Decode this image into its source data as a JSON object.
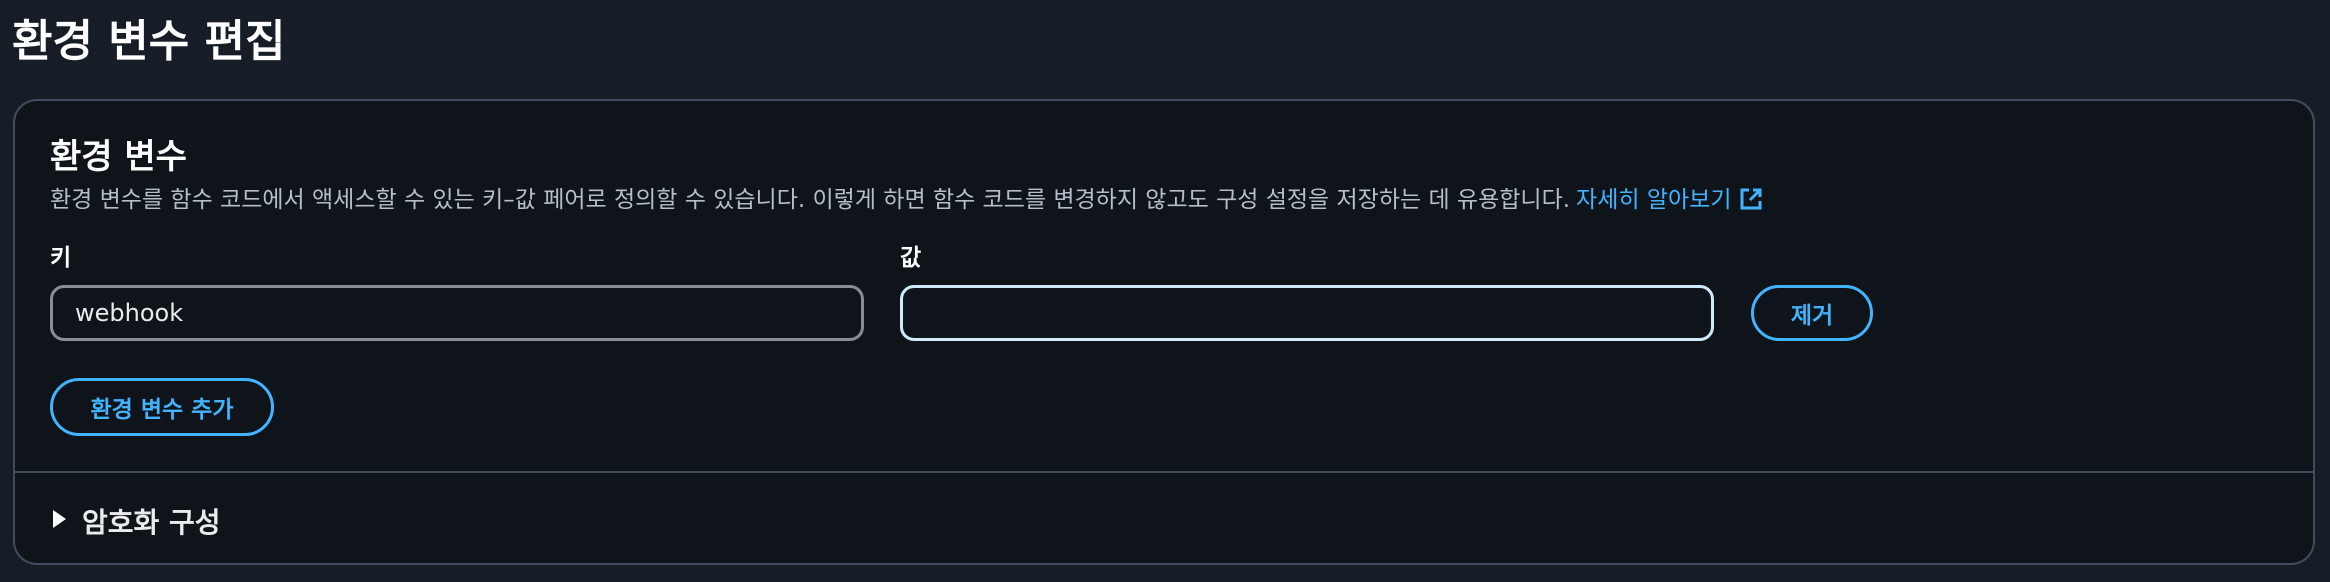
{
  "page": {
    "title": "환경 변수 편집"
  },
  "panel": {
    "title": "환경 변수",
    "description": "환경 변수를 함수 코드에서 액세스할 수 있는 키–값 페어로 정의할 수 있습니다. 이렇게 하면 함수 코드를 변경하지 않고도 구성 설정을 저장하는 데 유용합니다.",
    "learn_more": "자세히 알아보기",
    "learn_more_icon": "external-link-icon"
  },
  "fields": {
    "key_label": "키",
    "value_label": "값",
    "key_value": "webhook",
    "value_value": ""
  },
  "buttons": {
    "remove": "제거",
    "add": "환경 변수 추가"
  },
  "encryption": {
    "label": "암호화 구성",
    "icon": "caret-right-icon",
    "expanded": false
  },
  "colors": {
    "background": "#161d26",
    "panel": "#0f141a",
    "border": "#414d5c",
    "accent": "#42b4ff",
    "focus_border": "#cfeafa"
  }
}
